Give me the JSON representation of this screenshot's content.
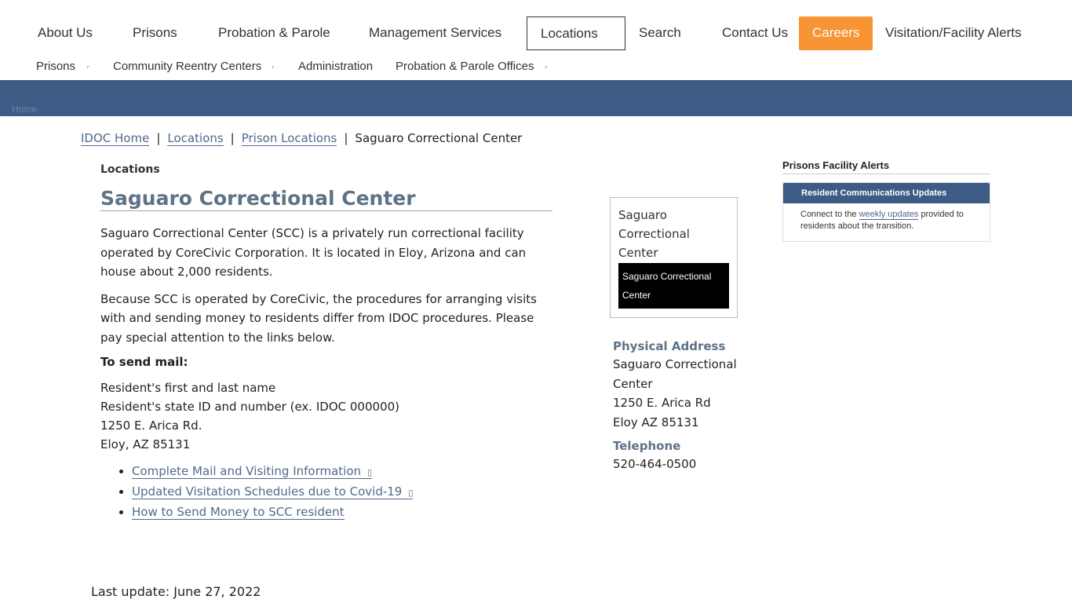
{
  "top_nav": {
    "about": "About Us",
    "prisons": "Prisons",
    "probation": "Probation & Parole",
    "management": "Management Services",
    "locations": "Locations",
    "search": "Search",
    "contact": "Contact Us",
    "careers": "Careers",
    "alerts": "Visitation/Facility Alerts"
  },
  "sub_nav": {
    "prisons": "Prisons",
    "reentry": "Community Reentry Centers",
    "administration": "Administration",
    "offices": "Probation & Parole Offices",
    "caret_icon": "corner-caret-icon"
  },
  "banner": {
    "home_alt": "Home"
  },
  "breadcrumb": {
    "home": "IDOC Home",
    "locations": "Locations",
    "prison_locations": "Prison Locations",
    "current": "Saguaro Correctional Center",
    "sep": "|"
  },
  "main": {
    "section_label": "Locations",
    "title": "Saguaro Correctional Center",
    "para1": "Saguaro Correctional Center (SCC) is a privately run correctional facility operated by CoreCivic Corporation. It is located in Eloy, Arizona and can house about 2,000 residents.",
    "para2": "Because SCC is operated by CoreCivic, the procedures for arranging visits with and sending money to residents differ from IDOC procedures. Please pay special attention to the links below.",
    "mail_heading": "To send mail:",
    "mail_lines": [
      "Resident's first and last name",
      "Resident's state ID and number (ex. IDOC 000000)",
      "1250 E. Arica Rd.",
      "Eloy, AZ 85131"
    ],
    "links": [
      "Complete Mail and Visiting Information",
      "Updated Visitation Schedules due to Covid-19",
      "How to Send Money to SCC resident"
    ],
    "external_icon": "▯"
  },
  "image_card": {
    "alt_text": "Saguaro Correctional Center",
    "caption": "Saguaro Correctional Center"
  },
  "address": {
    "heading": "Physical Address",
    "lines": [
      "Saguaro Correctional Center",
      "1250 E. Arica Rd",
      "Eloy  AZ  85131"
    ],
    "tel_heading": "Telephone",
    "tel": "520-464-0500"
  },
  "alerts": {
    "title": "Prisons Facility Alerts",
    "box_title": "Resident Communications Updates",
    "body_before": "Connect to the ",
    "body_link": "weekly updates",
    "body_after": " provided to residents about the transition."
  },
  "footer": {
    "last_update": "Last update: June 27, 2022"
  },
  "colors": {
    "brand_blue": "#3d5b85",
    "careers_orange": "#f79433",
    "link": "#4f6a8c",
    "heading_gray": "#5e7288"
  }
}
